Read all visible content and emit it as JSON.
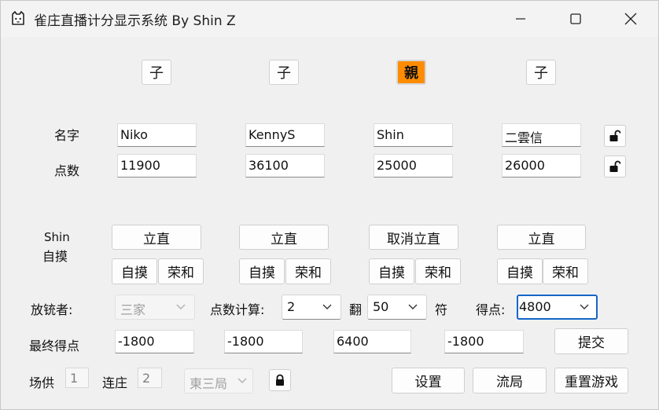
{
  "window": {
    "title": "雀庄直播计分显示系统 By Shin Z",
    "icon": "cat-face-icon"
  },
  "roles": [
    "子",
    "子",
    "親",
    "子"
  ],
  "labels": {
    "name": "名字",
    "points": "点数",
    "current_player_line1": "Shin",
    "current_player_line2": "自摸",
    "discarder": "放铳者:",
    "point_calc": "点数计算:",
    "han_label": "翻",
    "fu_label": "符",
    "score_label": "得点:",
    "final_score": "最终得点",
    "honba": "场供",
    "renchan": "连庄"
  },
  "players": [
    {
      "name": "Niko",
      "points": "11900",
      "riichi": "立直",
      "tsumo": "自摸",
      "ron": "荣和",
      "final": "-1800"
    },
    {
      "name": "KennyS",
      "points": "36100",
      "riichi": "立直",
      "tsumo": "自摸",
      "ron": "荣和",
      "final": "-1800"
    },
    {
      "name": "Shin",
      "points": "25000",
      "riichi": "取消立直",
      "tsumo": "自摸",
      "ron": "荣和",
      "final": "6400"
    },
    {
      "name": "二雲信",
      "points": "26000",
      "riichi": "立直",
      "tsumo": "自摸",
      "ron": "荣和",
      "final": "-1800"
    }
  ],
  "calc": {
    "discarder_value": "三家",
    "han_value": "2",
    "fu_value": "50",
    "score_value": "4800"
  },
  "buttons": {
    "submit": "提交",
    "settings": "设置",
    "draw": "流局",
    "reset": "重置游戏"
  },
  "status": {
    "honba_value": "1",
    "renchan_value": "2",
    "round_value": "東三局"
  },
  "colors": {
    "dealer": "#ff8c00",
    "focus": "#1466c8"
  }
}
